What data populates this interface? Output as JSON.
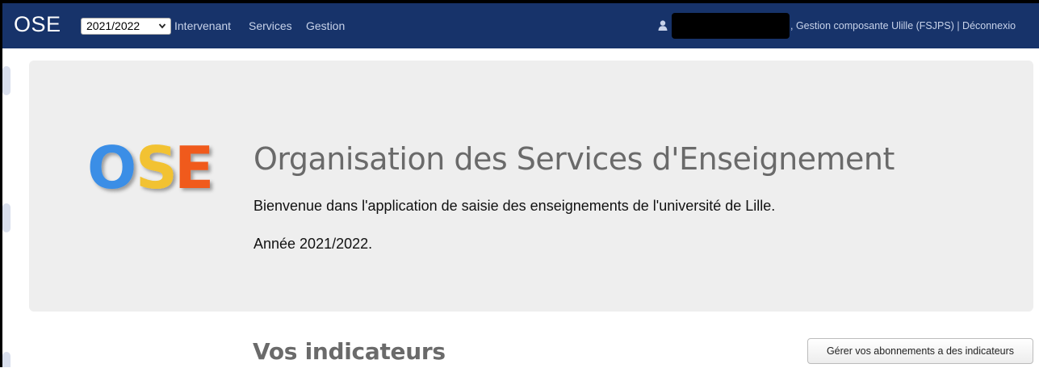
{
  "navbar": {
    "brand": "OSE",
    "year_select": {
      "value": "2021/2022"
    },
    "links": [
      {
        "label": "Intervenant"
      },
      {
        "label": "Services"
      },
      {
        "label": "Gestion"
      }
    ],
    "user_info": ", Gestion composante Ulille (FSJPS) | Déconnexio",
    "background_color": "#17336a"
  },
  "jumbotron": {
    "logo": {
      "letters": [
        "O",
        "S",
        "E"
      ],
      "colors": [
        "#3a8ee6",
        "#f2c230",
        "#f05a1e"
      ]
    },
    "title": "Organisation des Services d'Enseignement",
    "welcome": "Bienvenue dans l'application de saisie des enseignements de l'université de Lille.",
    "year_text": "Année 2021/2022."
  },
  "indicateurs": {
    "title": "Vos indicateurs",
    "manage_button": "Gérer vos abonnements a des indicateurs"
  }
}
